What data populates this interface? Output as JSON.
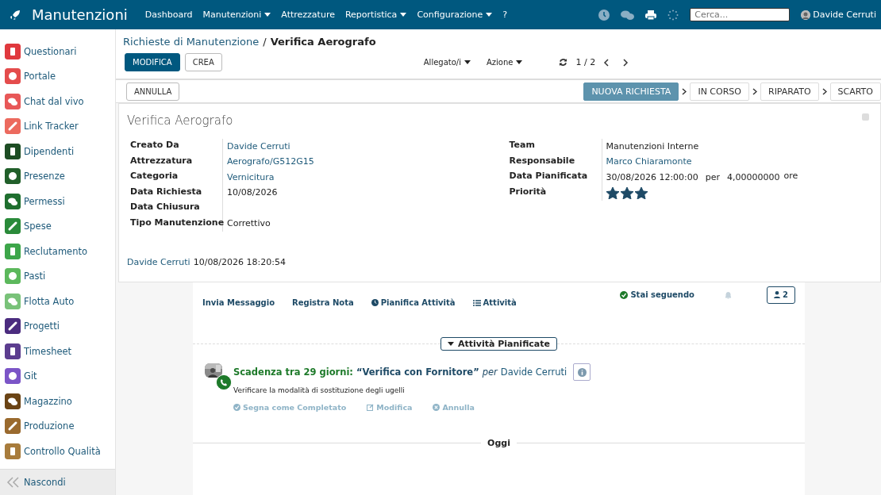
{
  "navbar": {
    "app_title": "Manutenzioni",
    "menu": [
      {
        "label": "Dashboard",
        "dropdown": false
      },
      {
        "label": "Manutenzioni",
        "dropdown": true
      },
      {
        "label": "Attrezzature",
        "dropdown": false
      },
      {
        "label": "Reportistica",
        "dropdown": true
      },
      {
        "label": "Configurazione",
        "dropdown": true
      },
      {
        "label": "?",
        "dropdown": false
      }
    ],
    "search": {
      "placeholder": "Cerca..."
    },
    "user": "Davide Cerruti"
  },
  "sidebar": {
    "items": [
      {
        "label": "Questionari",
        "color": "#e0393e"
      },
      {
        "label": "Portale",
        "color": "#e44c4c"
      },
      {
        "label": "Chat dal vivo",
        "color": "#e85858"
      },
      {
        "label": "Link Tracker",
        "color": "#ec6a5e"
      },
      {
        "label": "Dipendenti",
        "color": "#1d4d24"
      },
      {
        "label": "Presenze",
        "color": "#215f2a"
      },
      {
        "label": "Permessi",
        "color": "#1f6f2f"
      },
      {
        "label": "Spese",
        "color": "#2a8a3a"
      },
      {
        "label": "Reclutamento",
        "color": "#3da64a"
      },
      {
        "label": "Pasti",
        "color": "#5cb85c"
      },
      {
        "label": "Flotta Auto",
        "color": "#79c279"
      },
      {
        "label": "Progetti",
        "color": "#4b2c7f"
      },
      {
        "label": "Timesheet",
        "color": "#5c3d8f"
      },
      {
        "label": "Git",
        "color": "#7b55c7"
      },
      {
        "label": "Magazzino",
        "color": "#6b4415"
      },
      {
        "label": "Produzione",
        "color": "#9a6a2e"
      },
      {
        "label": "Controllo Qualità",
        "color": "#a87c3c"
      }
    ],
    "hide_label": "Nascondi"
  },
  "breadcrumb": {
    "parent": "Richieste di Manutenzione",
    "separator": "/",
    "current": "Verifica Aerografo"
  },
  "toolbar": {
    "edit": "MODIFICA",
    "create": "CREA",
    "attachment": "Allegato/i",
    "action": "Azione",
    "pager": "1 / 2"
  },
  "statusbar": {
    "cancel": "ANNULLA",
    "stages": [
      {
        "label": "NUOVA RICHIESTA",
        "selected": true
      },
      {
        "label": "IN CORSO",
        "selected": false
      },
      {
        "label": "RIPARATO",
        "selected": false
      },
      {
        "label": "SCARTO",
        "selected": false
      }
    ]
  },
  "form": {
    "title": "Verifica Aerografo",
    "left": [
      {
        "label": "Creato Da",
        "value": "Davide Cerruti",
        "link": true
      },
      {
        "label": "Attrezzatura",
        "value": "Aerografo/G512G15",
        "link": true
      },
      {
        "label": "Categoria",
        "value": "Vernicitura",
        "link": true
      },
      {
        "label": "Data Richiesta",
        "value": "10/08/2026",
        "link": false
      },
      {
        "label": "Data Chiusura"
      },
      {
        "label": "Tipo Manutenzione",
        "value": "Correttivo",
        "link": false
      }
    ],
    "right": [
      {
        "label": "Team",
        "kind": "text",
        "value": "Manutenzioni Interne",
        "link": false
      },
      {
        "label": "Responsabile",
        "kind": "text",
        "value": "Marco Chiaramonte",
        "link": true
      },
      {
        "label": "Data Pianificata",
        "kind": "schedule",
        "date": "30/08/2026 12:00:00",
        "per": "per",
        "duration": "4,00000000",
        "unit": "ore"
      },
      {
        "label": "Priorità",
        "kind": "priority",
        "stars": 3
      }
    ],
    "footer_user": "Davide Cerruti",
    "footer_time": "10/08/2026 18:20:54"
  },
  "chatter": {
    "actions": [
      "Invia Messaggio",
      "Registra Nota",
      "Pianifica Attività",
      "Attività"
    ],
    "following": "Stai seguendo",
    "followers": "2",
    "section": "Attività Pianificate",
    "activity": {
      "due": "Scadenza tra 29 giorni:",
      "title": "“Verifica con Fornitore”",
      "per": "per",
      "user": "Davide Cerruti",
      "note": "Verificare la modalità di sostituzione degli ugelli",
      "buttons": [
        "Segna come Completato",
        "Modifica",
        "Annulla"
      ]
    },
    "day": "Oggi"
  }
}
